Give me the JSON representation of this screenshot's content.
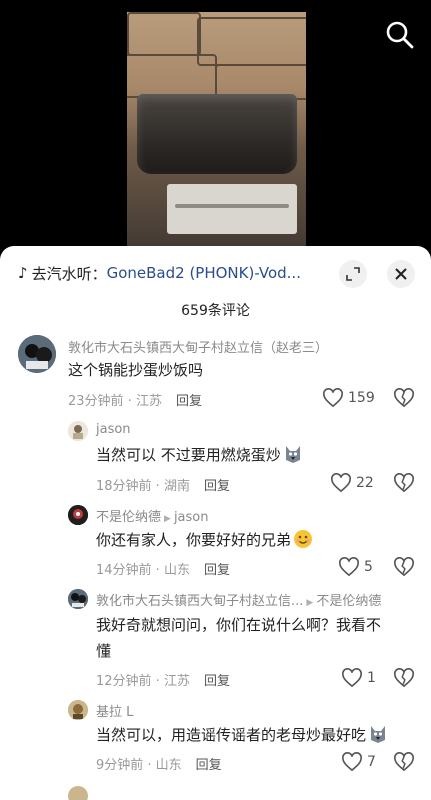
{
  "video": {
    "search_icon": "search-icon"
  },
  "sheet": {
    "music_icon": "♪",
    "music_prefix": "去汽水听：",
    "music_song": "GoneBad2 (PHONK)-Vod...",
    "count": "659条评论"
  },
  "comments": [
    {
      "username": "敦化市大石头镇西大甸子村赵立信（赵老三）",
      "text": "这个锅能抄蛋炒饭吗",
      "time_loc": "23分钟前 · 江苏",
      "reply": "回复",
      "likes": "159"
    },
    {
      "username": "jason",
      "text": "当然可以 不过要用燃烧蛋炒",
      "emoji": "wolf-emoji",
      "time_loc": "18分钟前 · 湖南",
      "reply": "回复",
      "likes": "22"
    },
    {
      "username": "不是伦纳德",
      "reply_to": "jason",
      "text": "你还有家人，你要好好的兄弟",
      "emoji": "smile-emoji",
      "time_loc": "14分钟前 · 山东",
      "reply": "回复",
      "likes": "5"
    },
    {
      "username": "敦化市大石头镇西大甸子村赵立信...",
      "reply_to": "不是伦纳德",
      "text_line1": "我好奇就想问问，你们在说什么啊？我看不",
      "text_line2": "懂",
      "time_loc": "12分钟前 · 江苏",
      "reply": "回复",
      "likes": "1"
    },
    {
      "username": "基拉 L",
      "text": "当然可以，用造谣传谣者的老母炒最好吃",
      "emoji": "wolf-emoji",
      "time_loc": "9分钟前 · 山东",
      "reply": "回复",
      "likes": "7"
    }
  ]
}
